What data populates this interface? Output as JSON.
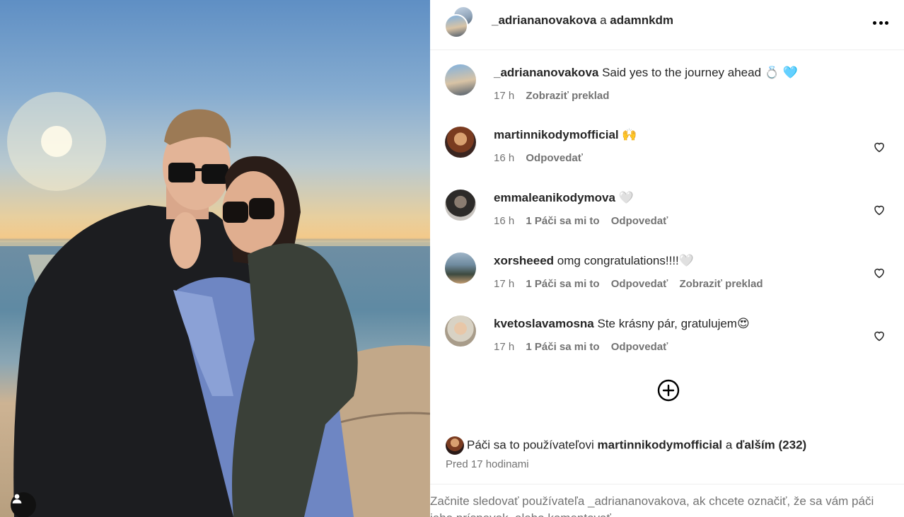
{
  "header": {
    "user1": "_adriananovakova",
    "conjunction": "a",
    "user2": "adamnkdm",
    "more_icon": "more-horizontal-icon"
  },
  "comments": [
    {
      "username": "_adriananovakova",
      "text": "Said yes to the journey ahead 💍 🩵",
      "time": "17 h",
      "likes": "",
      "reply": "",
      "translate": "Zobraziť preklad",
      "has_heart": false
    },
    {
      "username": "martinnikodymofficial",
      "text": "🙌",
      "time": "16 h",
      "likes": "",
      "reply": "Odpovedať",
      "translate": "",
      "has_heart": true
    },
    {
      "username": "emmaleanikodymova",
      "text": "🤍",
      "time": "16 h",
      "likes": "1 Páči sa mi to",
      "reply": "Odpovedať",
      "translate": "",
      "has_heart": true
    },
    {
      "username": "xorsheeed",
      "text": "omg congratulations!!!!🤍",
      "time": "17 h",
      "likes": "1 Páči sa mi to",
      "reply": "Odpovedať",
      "translate": "Zobraziť preklad",
      "has_heart": true
    },
    {
      "username": "kvetoslavamosna",
      "text": "Ste krásny pár, gratulujem😍",
      "time": "17 h",
      "likes": "1 Páči sa mi to",
      "reply": "Odpovedať",
      "translate": "",
      "has_heart": true
    }
  ],
  "likes": {
    "prefix": "Páči sa to používateľovi",
    "user": "martinnikodymofficial",
    "joiner": "a",
    "others": "ďalším (232)"
  },
  "post_time": "Pred 17 hodinami",
  "footer": {
    "text": "Začnite sledovať používateľa _adriananovakova, ak chcete označiť, že sa vám páči jeho príspevok, alebo komentovať."
  },
  "icons": {
    "load_more": "plus-circle-icon",
    "like": "heart-icon",
    "tagged_users": "user-icon"
  },
  "colors": {
    "text_primary": "#262626",
    "text_secondary": "#737373",
    "divider": "#efefef"
  }
}
